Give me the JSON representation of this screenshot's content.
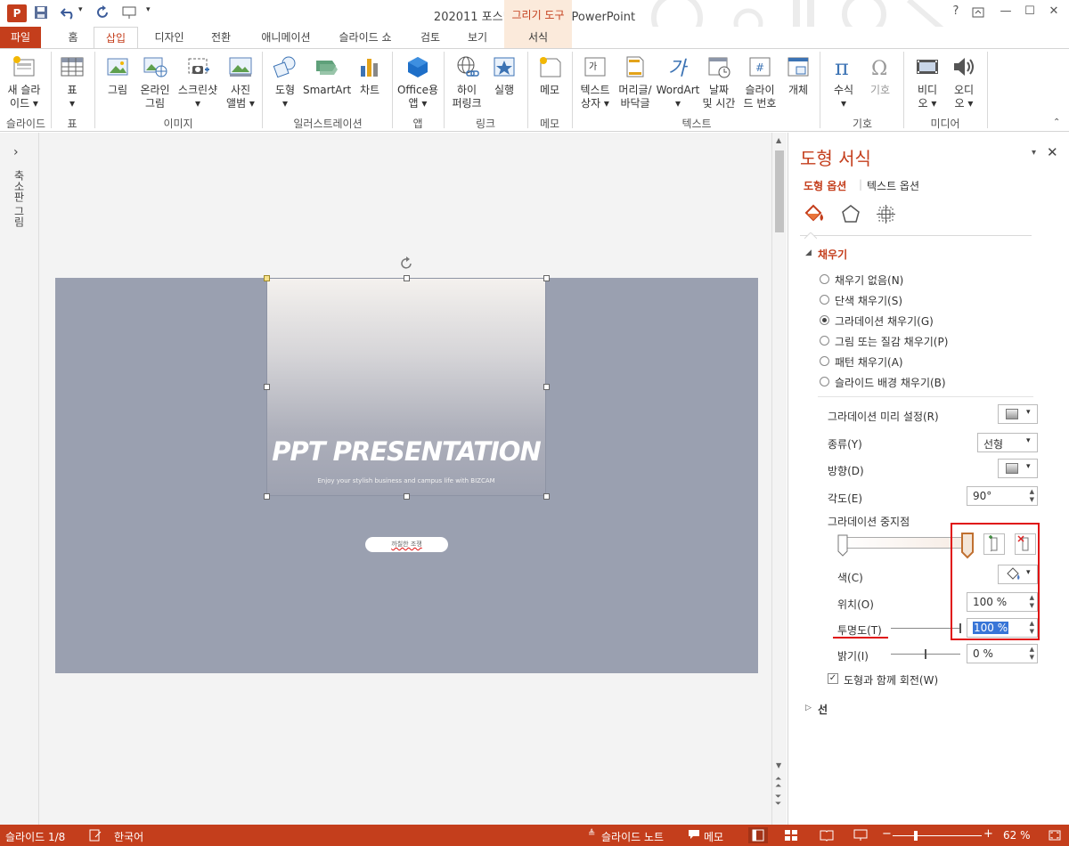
{
  "titlebar": {
    "document_title": "202011 포스팅용 완성본 - PowerPoint",
    "contextual_tab": "그리기 도구",
    "app_logo": "P"
  },
  "tabs": [
    "파일",
    "홈",
    "삽입",
    "디자인",
    "전환",
    "애니메이션",
    "슬라이드 쇼",
    "검토",
    "보기",
    "서식"
  ],
  "ribbon": {
    "buttons": [
      {
        "l1": "새 슬라",
        "l2": "이드 ▾",
        "icon": "new-slide-icon"
      },
      {
        "l1": "표",
        "l2": "▾",
        "icon": "table-icon"
      },
      {
        "l1": "그림",
        "l2": "",
        "icon": "picture-icon"
      },
      {
        "l1": "온라인",
        "l2": "그림",
        "icon": "online-picture-icon"
      },
      {
        "l1": "스크린샷",
        "l2": "▾",
        "icon": "screenshot-icon"
      },
      {
        "l1": "사진",
        "l2": "앨범 ▾",
        "icon": "photo-album-icon"
      },
      {
        "l1": "도형",
        "l2": "▾",
        "icon": "shapes-icon"
      },
      {
        "l1": "SmartArt",
        "l2": "",
        "icon": "smartart-icon"
      },
      {
        "l1": "차트",
        "l2": "",
        "icon": "chart-icon"
      },
      {
        "l1": "Office용",
        "l2": "앱 ▾",
        "icon": "office-apps-icon"
      },
      {
        "l1": "하이",
        "l2": "퍼링크",
        "icon": "hyperlink-icon"
      },
      {
        "l1": "실행",
        "l2": "",
        "icon": "action-icon"
      },
      {
        "l1": "메모",
        "l2": "",
        "icon": "comment-icon"
      },
      {
        "l1": "텍스트",
        "l2": "상자 ▾",
        "icon": "textbox-icon"
      },
      {
        "l1": "머리글/",
        "l2": "바닥글",
        "icon": "header-footer-icon"
      },
      {
        "l1": "WordArt",
        "l2": "▾",
        "icon": "wordart-icon"
      },
      {
        "l1": "날짜",
        "l2": "및 시간",
        "icon": "date-time-icon"
      },
      {
        "l1": "슬라이",
        "l2": "드 번호",
        "icon": "slide-number-icon"
      },
      {
        "l1": "개체",
        "l2": "",
        "icon": "object-icon"
      },
      {
        "l1": "수식",
        "l2": "▾",
        "icon": "equation-icon"
      },
      {
        "l1": "기호",
        "l2": "",
        "icon": "symbol-icon"
      },
      {
        "l1": "비디",
        "l2": "오 ▾",
        "icon": "video-icon"
      },
      {
        "l1": "오디",
        "l2": "오 ▾",
        "icon": "audio-icon"
      }
    ],
    "groups": [
      "슬라이드",
      "표",
      "이미지",
      "일러스트레이션",
      "앱",
      "링크",
      "메모",
      "텍스트",
      "기호",
      "미디어"
    ]
  },
  "left_rail": {
    "label": "축소판 그림",
    "toggle": "›"
  },
  "slide": {
    "title": "PPT PRESENTATION",
    "subtitle": "Enjoy your stylish business and campus life with BIZCAM",
    "pill_text": "까칠한 조쟁"
  },
  "pane": {
    "title": "도형 서식",
    "tab_shape": "도형 옵션",
    "tab_text": "텍스트 옵션",
    "section_fill": "채우기",
    "fill_options": [
      {
        "label": "채우기 없음(N)",
        "selected": false
      },
      {
        "label": "단색 채우기(S)",
        "selected": false
      },
      {
        "label": "그라데이션 채우기(G)",
        "selected": true
      },
      {
        "label": "그림 또는 질감 채우기(P)",
        "selected": false
      },
      {
        "label": "패턴 채우기(A)",
        "selected": false
      },
      {
        "label": "슬라이드 배경 채우기(B)",
        "selected": false
      }
    ],
    "preset_label": "그라데이션 미리 설정(R)",
    "type_label": "종류(Y)",
    "type_value": "선형",
    "direction_label": "방향(D)",
    "angle_label": "각도(E)",
    "angle_value": "90°",
    "stops_label": "그라데이션 중지점",
    "color_label": "색(C)",
    "position_label": "위치(O)",
    "position_value": "100 %",
    "transparency_label": "투명도(T)",
    "transparency_value": "100 %",
    "transparency_level": 1.0,
    "brightness_label": "밝기(I)",
    "brightness_value": "0 %",
    "brightness_level": 0.5,
    "rotate_label": "도형과 함께 회전(W)",
    "rotate_checked": true,
    "section_line": "선",
    "annotation_color": "#e01010"
  },
  "statusbar": {
    "slide_info": "슬라이드 1/8",
    "language": "한국어",
    "notes": "슬라이드 노트",
    "comments": "메모",
    "zoom": "62 %"
  },
  "colors": {
    "accent": "#c43e1c",
    "slide_bg": "#9aa0b0"
  }
}
